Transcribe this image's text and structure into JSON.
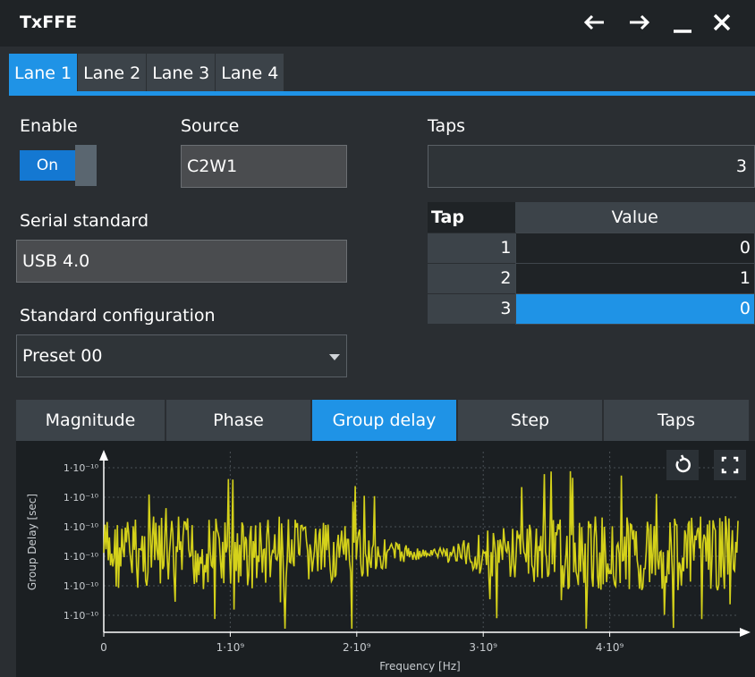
{
  "window": {
    "title": "TxFFE",
    "icons": [
      "arrow-left-icon",
      "arrow-right-icon",
      "minimize-icon",
      "close-icon"
    ]
  },
  "lane_tabs": [
    {
      "label": "Lane 1",
      "active": true
    },
    {
      "label": "Lane 2",
      "active": false
    },
    {
      "label": "Lane 3",
      "active": false
    },
    {
      "label": "Lane 4",
      "active": false
    }
  ],
  "enable": {
    "label": "Enable",
    "state": "On"
  },
  "source": {
    "label": "Source",
    "value": "C2W1"
  },
  "serial_standard": {
    "label": "Serial standard",
    "value": "USB 4.0"
  },
  "standard_configuration": {
    "label": "Standard configuration",
    "value": "Preset 00"
  },
  "taps": {
    "label": "Taps",
    "value": "3",
    "table": {
      "headers": [
        "Tap",
        "Value"
      ],
      "rows": [
        {
          "tap": "1",
          "value": "0",
          "selected": false
        },
        {
          "tap": "2",
          "value": "1",
          "selected": false
        },
        {
          "tap": "3",
          "value": "0",
          "selected": true
        }
      ]
    }
  },
  "chart_tabs": [
    {
      "label": "Magnitude",
      "active": false
    },
    {
      "label": "Phase",
      "active": false
    },
    {
      "label": "Group delay",
      "active": true
    },
    {
      "label": "Step",
      "active": false
    },
    {
      "label": "Taps",
      "active": false
    }
  ],
  "chart_buttons": [
    "reset-zoom-icon",
    "fullscreen-icon"
  ],
  "colors": {
    "accent": "#1f93e6",
    "trace": "#d4d11a",
    "panel": "#2a2e32",
    "titlebar": "#1f2326"
  },
  "chart_data": {
    "type": "line",
    "xlabel": "Frequency [Hz]",
    "ylabel": "Group Delay [sec]",
    "x_ticks": [
      "0",
      "1·10⁹",
      "2·10⁹",
      "3·10⁹",
      "4·10⁹"
    ],
    "x_tick_values": [
      0,
      1000000000,
      2000000000,
      3000000000,
      4000000000
    ],
    "y_ticks": [
      "1·10⁻¹⁰",
      "1·10⁻¹⁰",
      "1·10⁻¹⁰",
      "1·10⁻¹⁰",
      "1·10⁻¹⁰",
      "1·10⁻¹⁰"
    ],
    "xlim": [
      0,
      5000000000
    ],
    "ylim": [
      1e-10,
      1e-10
    ],
    "grid": true,
    "series": [
      {
        "color": "#d4d11a",
        "x": [
          0,
          100000000,
          200000000,
          300000000,
          400000000,
          500000000,
          600000000,
          700000000,
          800000000,
          900000000,
          1000000000,
          1100000000,
          1200000000,
          1300000000,
          1400000000,
          1500000000,
          1600000000,
          1700000000,
          1800000000,
          1900000000,
          2000000000,
          2100000000,
          2200000000,
          2300000000,
          2400000000,
          2500000000,
          2600000000,
          2700000000,
          2800000000,
          2900000000,
          3000000000,
          3100000000,
          3200000000,
          3300000000,
          3400000000,
          3500000000,
          3600000000,
          3700000000,
          3800000000,
          3900000000,
          4000000000,
          4100000000,
          4200000000,
          4300000000,
          4400000000,
          4500000000,
          4600000000,
          4700000000,
          4800000000,
          4900000000
        ],
        "values": [
          1e-10,
          1e-10,
          1e-10,
          1e-10,
          1e-10,
          1e-10,
          1e-10,
          1e-10,
          1e-10,
          1e-10,
          1e-10,
          1e-10,
          1e-10,
          1e-10,
          1e-10,
          1e-10,
          1e-10,
          1e-10,
          1e-10,
          1e-10,
          1e-10,
          1e-10,
          1e-10,
          1e-10,
          1e-10,
          1e-10,
          1e-10,
          1e-10,
          1e-10,
          1e-10,
          1e-10,
          1e-10,
          1e-10,
          1e-10,
          1e-10,
          1e-10,
          1e-10,
          1e-10,
          1e-10,
          1e-10,
          1e-10,
          1e-10,
          1e-10,
          1e-10,
          1e-10,
          1e-10,
          1e-10,
          1e-10,
          1e-10,
          1e-10
        ]
      }
    ]
  }
}
